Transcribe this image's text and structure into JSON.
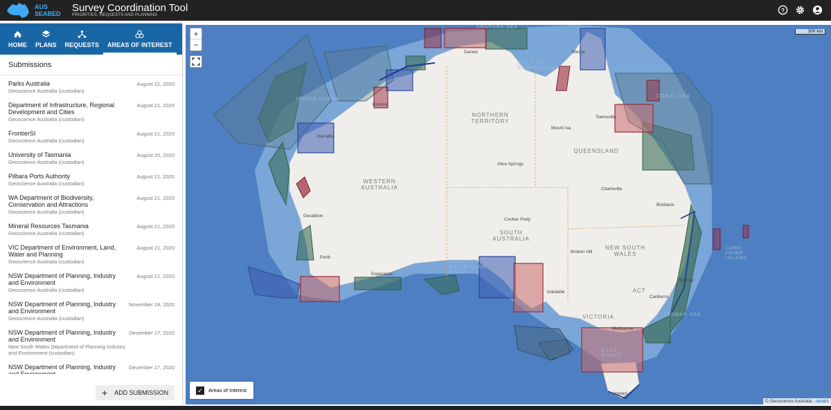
{
  "header": {
    "logo_top": "AUS",
    "logo_bottom": "SEABED",
    "title": "Survey Coordination Tool",
    "subtitle": "PRIORITIES, REQUESTS AND PLANNING"
  },
  "nav": {
    "items": [
      {
        "label": "HOME",
        "icon": "home-icon"
      },
      {
        "label": "PLANS",
        "icon": "layers-icon"
      },
      {
        "label": "REQUESTS",
        "icon": "requests-icon"
      },
      {
        "label": "AREAS OF INTEREST",
        "icon": "areas-icon",
        "active": true
      }
    ]
  },
  "submissions": {
    "heading": "Submissions",
    "items": [
      {
        "name": "Parks Australia",
        "custodian": "Geoscience Australia (custodian)",
        "date": "August 21, 2020"
      },
      {
        "name": "Department of Infrastructure, Regional Development and Cities",
        "custodian": "Geoscience Australia (custodian)",
        "date": "August 21, 2020"
      },
      {
        "name": "FrontierSI",
        "custodian": "Geoscience Australia (custodian)",
        "date": "August 21, 2020"
      },
      {
        "name": "University of Tasmania",
        "custodian": "Geoscience Australia (custodian)",
        "date": "August 20, 2020"
      },
      {
        "name": "Pilbara Ports Authority",
        "custodian": "Geoscience Australia (custodian)",
        "date": "August 21, 2020"
      },
      {
        "name": "WA Department of Biodiversity, Conservation and Attractions",
        "custodian": "Geoscience Australia (custodian)",
        "date": "August 21, 2020"
      },
      {
        "name": "Mineral Resources Tasmania",
        "custodian": "Geoscience Australia (custodian)",
        "date": "August 21, 2020"
      },
      {
        "name": "VIC Department of Environment, Land, Water and Planning",
        "custodian": "Geoscience Australia (custodian)",
        "date": "August 21, 2020"
      },
      {
        "name": "NSW Department of Planning, Industry and Environment",
        "custodian": "Geoscience Australia (custodian)",
        "date": "August 21, 2020"
      },
      {
        "name": "NSW Department of Planning, Industry and Environment",
        "custodian": "Geoscience Australia (custodian)",
        "date": "November 24, 2020"
      },
      {
        "name": "NSW Department of Planning, Industry and Environment",
        "custodian": "New South Wales Department of Planning Industry and Environment (custodian)",
        "date": "December 17, 2020"
      },
      {
        "name": "NSW Department of Planning, Industry and Environment",
        "custodian": "",
        "date": "December 17, 2020"
      }
    ],
    "add_label": "ADD SUBMISSION"
  },
  "map": {
    "zoom_in": "+",
    "zoom_out": "−",
    "scale": "300 km",
    "legend_label": "Areas of Interest",
    "attribution": "© Geoscience Australia - ",
    "attribution_link": "details",
    "regions": {
      "nt": "NORTHERN TERRITORY",
      "qld": "QUEENSLAND",
      "wa": "WESTERN AUSTRALIA",
      "sa": "SOUTH AUSTRALIA",
      "nsw": "NEW SOUTH WALES",
      "vic": "VICTORIA",
      "act": "ACT"
    },
    "seas": {
      "indian": "INDIAN OCEAN",
      "arafura": "ARAFURA SEA",
      "coral": "CORAL SEA",
      "tasman": "TASMAN SEA",
      "gulf": "GULF OF CARPENTARIA",
      "bight": "GREAT AUSTRALIAN BIGHT",
      "bass": "BASS STRAIT",
      "lordhowe": "LORD HOWE ISLAND"
    },
    "cities": [
      "Darwin",
      "Broome",
      "Karratha",
      "Mount Isa",
      "Townsville",
      "Alice Springs",
      "Charleville",
      "Brisbane",
      "Coober Pedy",
      "Geraldton",
      "Perth",
      "Broken Hill",
      "Esperance",
      "Adelaide",
      "Sydney",
      "Canberra",
      "Melbourne",
      "Hobart",
      "Weipa"
    ]
  }
}
